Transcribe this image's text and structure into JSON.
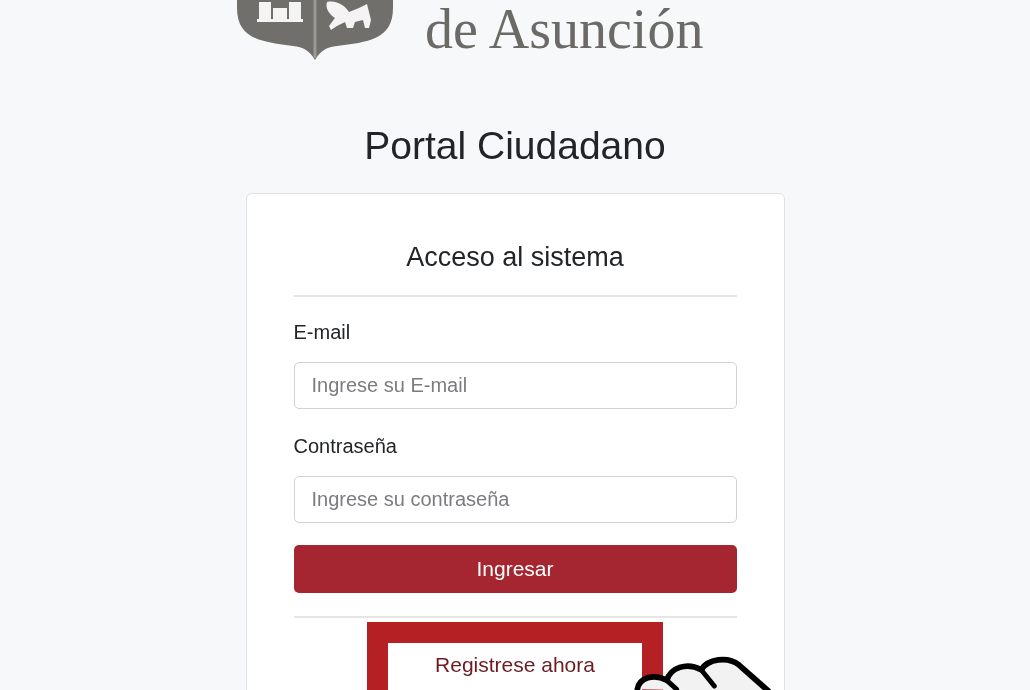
{
  "logo": {
    "text": "de Asunción"
  },
  "page_title": "Portal Ciudadano",
  "login_card": {
    "title": "Acceso al sistema",
    "fields": [
      {
        "label": "E-mail",
        "placeholder": "Ingrese su E-mail"
      },
      {
        "label": "Contraseña",
        "placeholder": "Ingrese su contraseña"
      }
    ],
    "submit_button": "Ingresar",
    "register_button": {
      "label": "Registrese ahora",
      "highlighted": true,
      "hovered": true
    }
  }
}
